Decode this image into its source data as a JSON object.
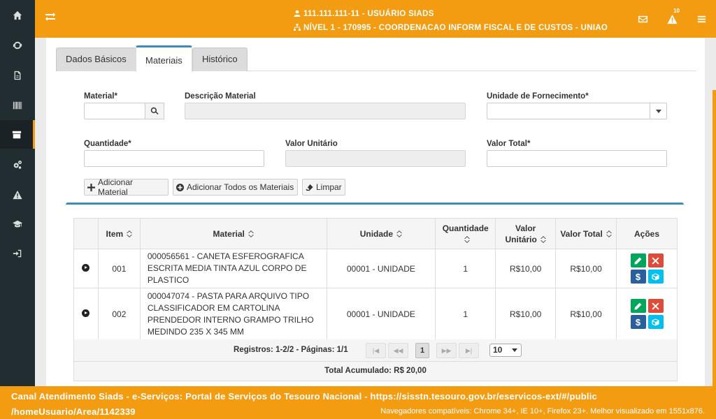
{
  "sidebar": {
    "items": [
      {
        "icon": "home-icon"
      },
      {
        "icon": "refresh-icon"
      },
      {
        "icon": "file-icon"
      },
      {
        "icon": "barcode-icon"
      },
      {
        "icon": "archive-icon",
        "active": true
      },
      {
        "icon": "gears-icon"
      },
      {
        "icon": "warning-icon"
      },
      {
        "icon": "graduation-cap-icon"
      },
      {
        "icon": "sign-in-icon"
      }
    ]
  },
  "header": {
    "user_line": "111.111.111-11 - USUÁRIO SIADS",
    "unit_line": "NÍVEL 1 - 170995 - COORDENACAO INFORM FISCAL E DE CUSTOS - UNIAO",
    "notification_count": "10",
    "accent": "#f39c12"
  },
  "tabs": [
    {
      "label": "Dados Básicos",
      "active": false
    },
    {
      "label": "Materiais",
      "active": true
    },
    {
      "label": "Histórico",
      "active": false
    }
  ],
  "form": {
    "material_label": "Material*",
    "material_value": "",
    "descricao_label": "Descrição Material",
    "descricao_value": "",
    "unidade_label": "Unidade de Fornecimento*",
    "unidade_value": "",
    "quantidade_label": "Quantidade*",
    "quantidade_value": "",
    "valor_unitario_label": "Valor Unitário",
    "valor_unitario_value": "",
    "valor_total_label": "Valor Total*",
    "valor_total_value": ""
  },
  "actions": {
    "adicionar": "Adicionar Material",
    "adicionar_todos": "Adicionar Todos os Materiais",
    "limpar": "Limpar"
  },
  "table": {
    "headers": {
      "item": "Item",
      "material": "Material",
      "unidade": "Unidade",
      "quantidade": "Quantidade",
      "valor_unitario": "Valor Unitário",
      "valor_total": "Valor Total",
      "acoes": "Ações"
    },
    "rows": [
      {
        "item": "001",
        "material": "000056561 - CANETA ESFEROGRAFICA ESCRITA MEDIA TINTA AZUL CORPO DE PLASTICO",
        "unidade": "00001 - UNIDADE",
        "quantidade": "1",
        "valor_unitario": "R$10,00",
        "valor_total": "R$10,00"
      },
      {
        "item": "002",
        "material": "000047074 - PASTA PARA ARQUIVO TIPO CLASSIFICADOR EM CARTOLINA PRENDEDOR INTERNO GRAMPO TRILHO MEDINDO 235 X 345 MM",
        "unidade": "00001 - UNIDADE",
        "quantidade": "1",
        "valor_unitario": "R$10,00",
        "valor_total": "R$10,00"
      }
    ],
    "action_labels": {
      "dollar": "$"
    }
  },
  "pager": {
    "info": "Registros: 1-2/2 - Páginas: 1/1",
    "first": "|◀",
    "prev": "◀◀",
    "current": "1",
    "next": "▶▶",
    "last": "▶|",
    "page_size": "10"
  },
  "total": "Total Acumulado: R$ 20,00",
  "footer": {
    "link": "Canal Atendimento Siads - e-Serviços: Portal de Serviços do Tesouro Nacional - https://sisstn.tesouro.gov.br/eservicos-ext/#/public /homeUsuario/Area/1142339",
    "compat": "Navegadores compatíveis: Chrome 34+, IE 10+, Firefox 23+. Melhor visualizado em 1551x876."
  }
}
